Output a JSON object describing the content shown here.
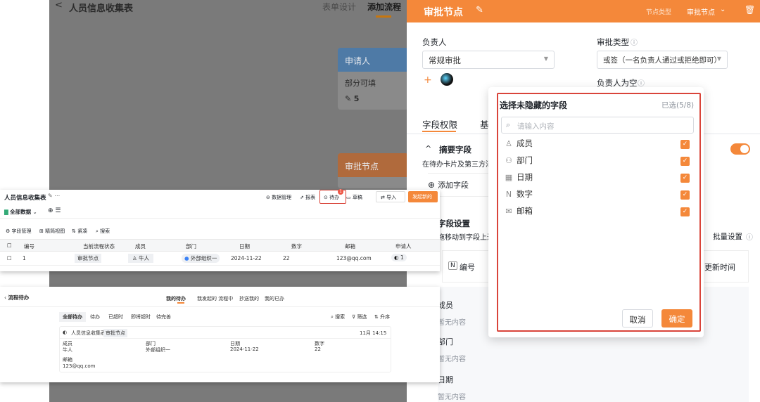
{
  "editor": {
    "back": "<",
    "title": "人员信息收集表",
    "tab_form": "表单设计",
    "tab_flow": "添加流程",
    "card_applicant": {
      "title": "申请人",
      "line1": "部分可填",
      "line2": "5"
    },
    "card_approve": {
      "title": "审批节点"
    }
  },
  "panel": {
    "title": "审批节点",
    "top_right": [
      "节点类型",
      "审批节点"
    ],
    "owner_label": "负责人",
    "owner_value": "常规审批",
    "approve_type_label": "审批类型",
    "approve_type_value": "或签（一名负责人通过或拒绝即可）",
    "empty_owner_label": "负责人为空",
    "tab_field_perm": "字段权限",
    "tab_basic": "基",
    "summary_label": "摘要字段",
    "summary_desc": "在待办卡片及第三方消",
    "add_field": "添加字段",
    "field_settings": "字段设置",
    "field_settings_desc": "拖移动到字段上进",
    "batch_settings": "批量设置",
    "field_number": "编号",
    "field_update_time": "更新时间",
    "rows": [
      {
        "name": "成员",
        "value": "暂无内容"
      },
      {
        "name": "部门",
        "value": "暂无内容"
      },
      {
        "name": "日期",
        "value": "暂无内容"
      }
    ]
  },
  "dropdown": {
    "title": "选择未隐藏的字段",
    "count": "已选(5/8)",
    "search_placeholder": "请输入内容",
    "items": [
      {
        "icon": "user-icon",
        "glyph": "♙",
        "label": "成员",
        "checked": true
      },
      {
        "icon": "org-icon",
        "glyph": "⚇",
        "label": "部门",
        "checked": true
      },
      {
        "icon": "calendar-icon",
        "glyph": "▦",
        "label": "日期",
        "checked": true
      },
      {
        "icon": "number-icon",
        "glyph": "N",
        "label": "数字",
        "checked": true
      },
      {
        "icon": "mail-icon",
        "glyph": "✉",
        "label": "邮箱",
        "checked": true
      }
    ],
    "cancel": "取消",
    "confirm": "确定"
  },
  "ss1": {
    "title": "人员信息收集表",
    "toolbar": [
      "数据管理",
      "报表",
      "待办",
      "草稿",
      "导入",
      "发起新的"
    ],
    "view": "全部数据",
    "tools": [
      "字段管理",
      "精简视图",
      "紧凑",
      "搜索"
    ],
    "columns": [
      "编号",
      "当前流程状态",
      "成员",
      "部门",
      "日期",
      "数字",
      "邮箱",
      "申请人"
    ],
    "row": [
      "1",
      "审批节点",
      "牛人",
      "外部组织一",
      "2024-11-22",
      "22",
      "123@qq.com",
      "1"
    ]
  },
  "ss2": {
    "back_title": "流程待办",
    "tabs": [
      "我的待办",
      "我发起的 流程中",
      "抄送我的",
      "我的已办"
    ],
    "filters": [
      "全部待办",
      "待办",
      "已超时",
      "即将超时",
      "待完善"
    ],
    "tools": [
      "搜索",
      "筛选",
      "升序"
    ],
    "card_title": "人员信息收集表",
    "card_badge": "审批节点",
    "card_time": "11月 14:15",
    "fields": [
      {
        "label": "成员",
        "value": "牛人"
      },
      {
        "label": "部门",
        "value": "外部组织一"
      },
      {
        "label": "日期",
        "value": "2024-11-22"
      },
      {
        "label": "数字",
        "value": "22"
      }
    ],
    "mail_label": "邮箱",
    "mail_value": "123@qq.com"
  },
  "colors": {
    "accent": "#f4883a",
    "highlight": "#d9443a"
  }
}
